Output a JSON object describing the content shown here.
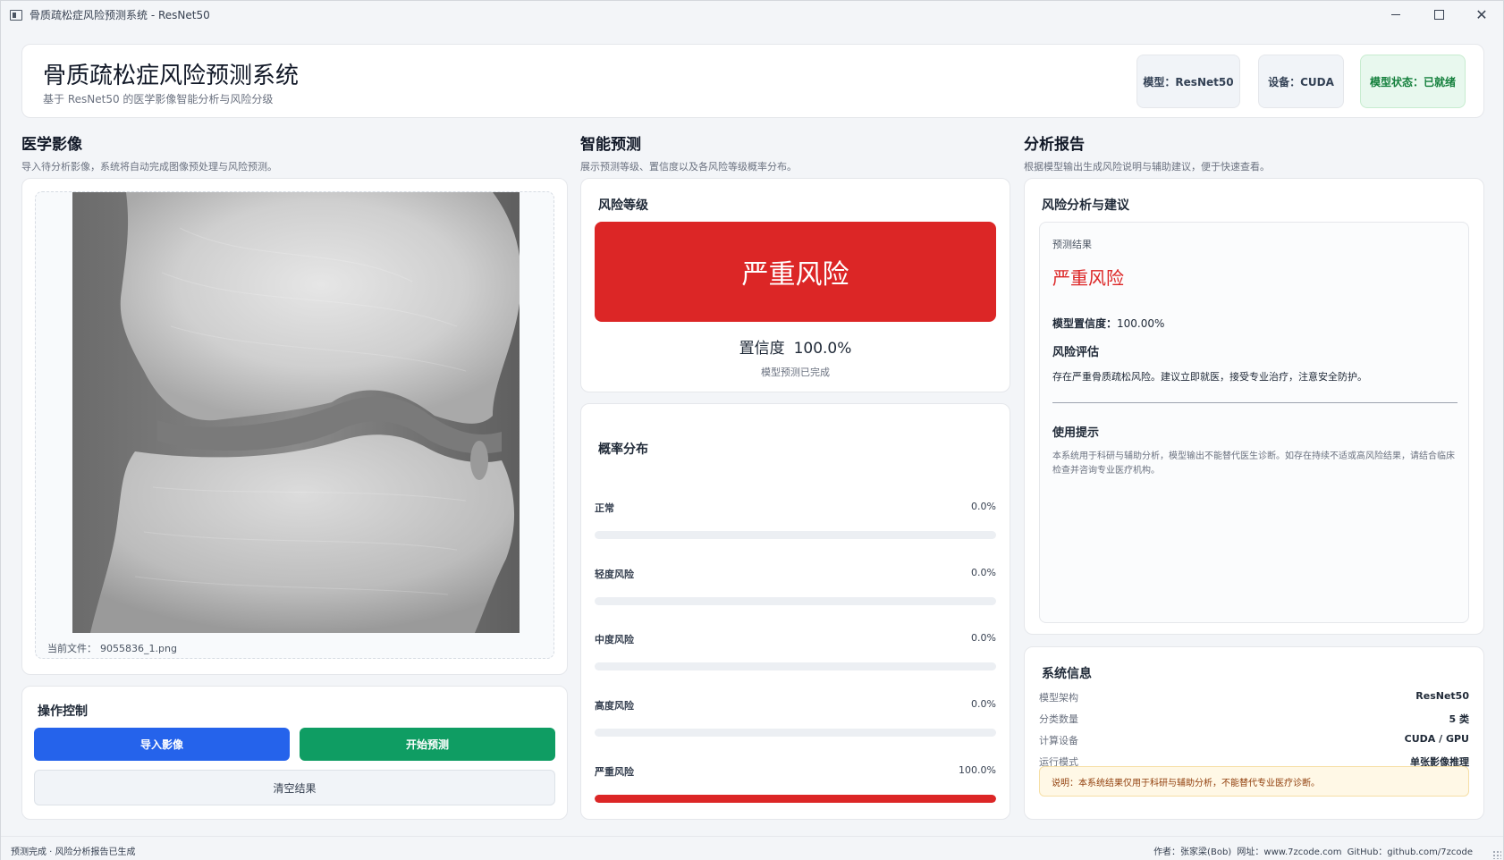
{
  "window": {
    "title": "骨质疏松症风险预测系统 - ResNet50"
  },
  "header": {
    "title": "骨质疏松症风险预测系统",
    "subtitle": "基于 ResNet50 的医学影像智能分析与风险分级",
    "badges": {
      "model": "模型：ResNet50",
      "device": "设备：CUDA",
      "status": "模型状态：已就绪"
    }
  },
  "sections": {
    "image": {
      "title": "医学影像",
      "desc": "导入待分析影像，系统将自动完成图像预处理与风险预测。"
    },
    "predict": {
      "title": "智能预测",
      "desc": "展示预测等级、置信度以及各风险等级概率分布。"
    },
    "report": {
      "title": "分析报告",
      "desc": "根据模型输出生成风险说明与辅助建议，便于快速查看。"
    }
  },
  "image_panel": {
    "file_label": "当前文件：",
    "file_name": "9055836_1.png"
  },
  "controls": {
    "title": "操作控制",
    "import_label": "导入影像",
    "predict_label": "开始预测",
    "clear_label": "清空结果"
  },
  "risk": {
    "title": "风险等级",
    "level": "严重风险",
    "confidence_label": "置信度",
    "confidence_value": "100.0%",
    "status": "模型预测已完成",
    "colors": {
      "severe": "#dc2626"
    }
  },
  "probability": {
    "title": "概率分布",
    "rows": [
      {
        "label": "正常",
        "value": "0.0%",
        "fraction": 0.0
      },
      {
        "label": "轻度风险",
        "value": "0.0%",
        "fraction": 0.0
      },
      {
        "label": "中度风险",
        "value": "0.0%",
        "fraction": 0.0
      },
      {
        "label": "高度风险",
        "value": "0.0%",
        "fraction": 0.0
      },
      {
        "label": "严重风险",
        "value": "100.0%",
        "fraction": 1.0
      }
    ]
  },
  "report": {
    "title": "风险分析与建议",
    "result_label": "预测结果",
    "result_value": "严重风险",
    "confidence_label": "模型置信度：",
    "confidence_value": "100.00%",
    "assessment_title": "风险评估",
    "assessment_text": "存在严重骨质疏松风险。建议立即就医，接受专业治疗，注意安全防护。",
    "tips_title": "使用提示",
    "tips_text": "本系统用于科研与辅助分析，模型输出不能替代医生诊断。如存在持续不适或高风险结果，请结合临床检查并咨询专业医疗机构。"
  },
  "system_info": {
    "title": "系统信息",
    "rows": [
      {
        "key": "模型架构",
        "value": "ResNet50"
      },
      {
        "key": "分类数量",
        "value": "5 类"
      },
      {
        "key": "计算设备",
        "value": "CUDA / GPU"
      },
      {
        "key": "运行模式",
        "value": "单张影像推理"
      }
    ],
    "note": "说明：本系统结果仅用于科研与辅助分析，不能替代专业医疗诊断。"
  },
  "statusbar": {
    "left": "预测完成 · 风险分析报告已生成",
    "author": "作者：张家梁(Bob)",
    "site": "网址：www.7zcode.com",
    "github": "GitHub：github.com/7zcode"
  }
}
